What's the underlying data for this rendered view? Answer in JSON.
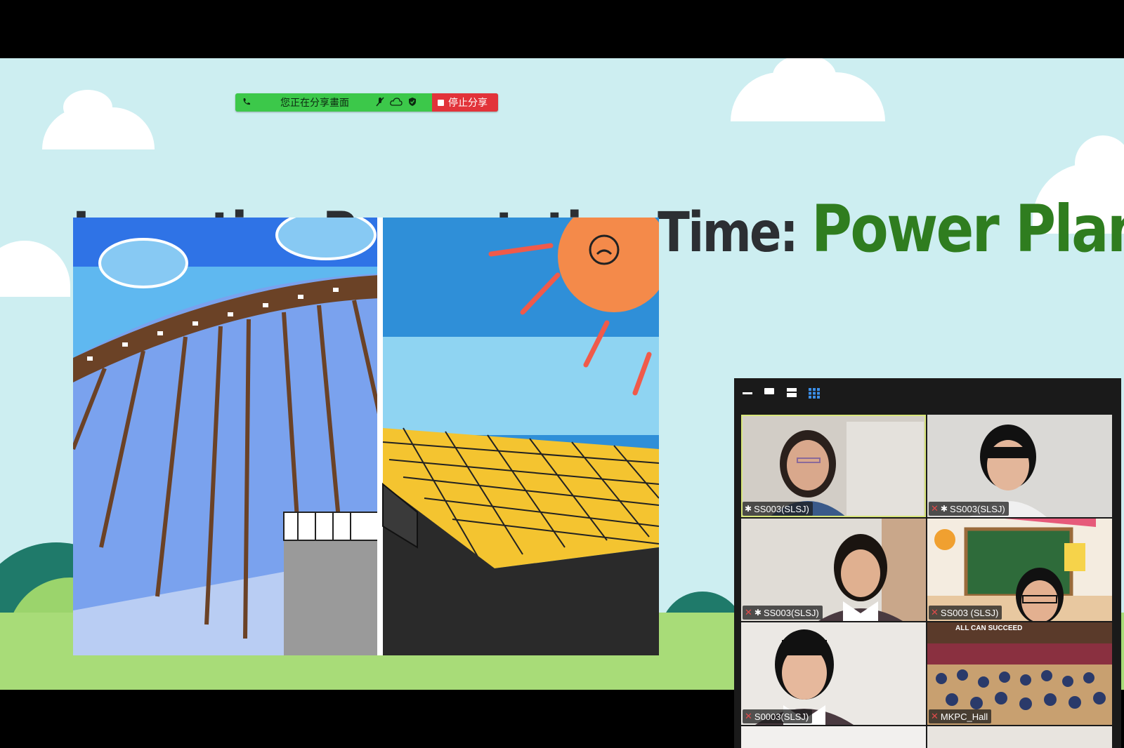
{
  "slide": {
    "title_main": "Invention Presentation Time: ",
    "title_accent": "Power Plant"
  },
  "share_bar": {
    "status": "您正在分享畫面",
    "stop_label": "停止分享",
    "color": "#3cc84a",
    "stop_color": "#e2333a"
  },
  "gallery": {
    "toolbar": [
      "minimize-icon",
      "single-view-icon",
      "speaker-view-icon",
      "gallery-view-icon"
    ],
    "tiles": [
      {
        "name": "SS003(SLSJ)",
        "mic_muted": false,
        "pinned": true,
        "active": true
      },
      {
        "name": "SS003(SLSJ)",
        "mic_muted": true,
        "pinned": true,
        "active": false
      },
      {
        "name": "SS003(SLSJ)",
        "mic_muted": true,
        "pinned": true,
        "active": false
      },
      {
        "name": "SS003 (SLSJ)",
        "mic_muted": true,
        "pinned": false,
        "active": false
      },
      {
        "name": "S0003(SLSJ)",
        "mic_muted": true,
        "pinned": false,
        "active": false
      },
      {
        "name": "MKPC_Hall",
        "mic_muted": true,
        "pinned": false,
        "active": false
      }
    ],
    "hall_banner": "ALL CAN SUCCEED"
  }
}
